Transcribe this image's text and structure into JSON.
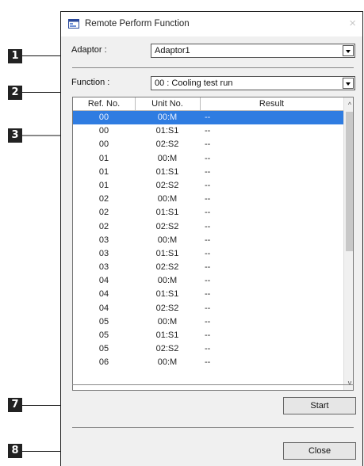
{
  "window": {
    "title": "Remote Perform Function",
    "close_glyph": "×",
    "icon": "app-window-icon"
  },
  "adaptor": {
    "label": "Adaptor :",
    "value": "Adaptor1"
  },
  "function": {
    "label": "Function :",
    "value": "00 : Cooling test run"
  },
  "table": {
    "columns": [
      "Ref. No.",
      "Unit No.",
      "Result"
    ],
    "rows": [
      {
        "ref": "00",
        "unit": "00:M",
        "result": "--"
      },
      {
        "ref": "00",
        "unit": "01:S1",
        "result": "--"
      },
      {
        "ref": "00",
        "unit": "02:S2",
        "result": "--"
      },
      {
        "ref": "01",
        "unit": "00:M",
        "result": "--"
      },
      {
        "ref": "01",
        "unit": "01:S1",
        "result": "--"
      },
      {
        "ref": "01",
        "unit": "02:S2",
        "result": "--"
      },
      {
        "ref": "02",
        "unit": "00:M",
        "result": "--"
      },
      {
        "ref": "02",
        "unit": "01:S1",
        "result": "--"
      },
      {
        "ref": "02",
        "unit": "02:S2",
        "result": "--"
      },
      {
        "ref": "03",
        "unit": "00:M",
        "result": "--"
      },
      {
        "ref": "03",
        "unit": "01:S1",
        "result": "--"
      },
      {
        "ref": "03",
        "unit": "02:S2",
        "result": "--"
      },
      {
        "ref": "04",
        "unit": "00:M",
        "result": "--"
      },
      {
        "ref": "04",
        "unit": "01:S1",
        "result": "--"
      },
      {
        "ref": "04",
        "unit": "02:S2",
        "result": "--"
      },
      {
        "ref": "05",
        "unit": "00:M",
        "result": "--"
      },
      {
        "ref": "05",
        "unit": "01:S1",
        "result": "--"
      },
      {
        "ref": "05",
        "unit": "02:S2",
        "result": "--"
      },
      {
        "ref": "06",
        "unit": "00:M",
        "result": "--"
      }
    ],
    "selected_row": 0,
    "scroll_up_glyph": "^",
    "scroll_down_glyph": "v"
  },
  "buttons": {
    "start": "Start",
    "close": "Close"
  },
  "callouts": [
    "1",
    "2",
    "3",
    "7",
    "8"
  ],
  "colors": {
    "selection": "#2f7ce1",
    "callout_bg": "#222222"
  }
}
